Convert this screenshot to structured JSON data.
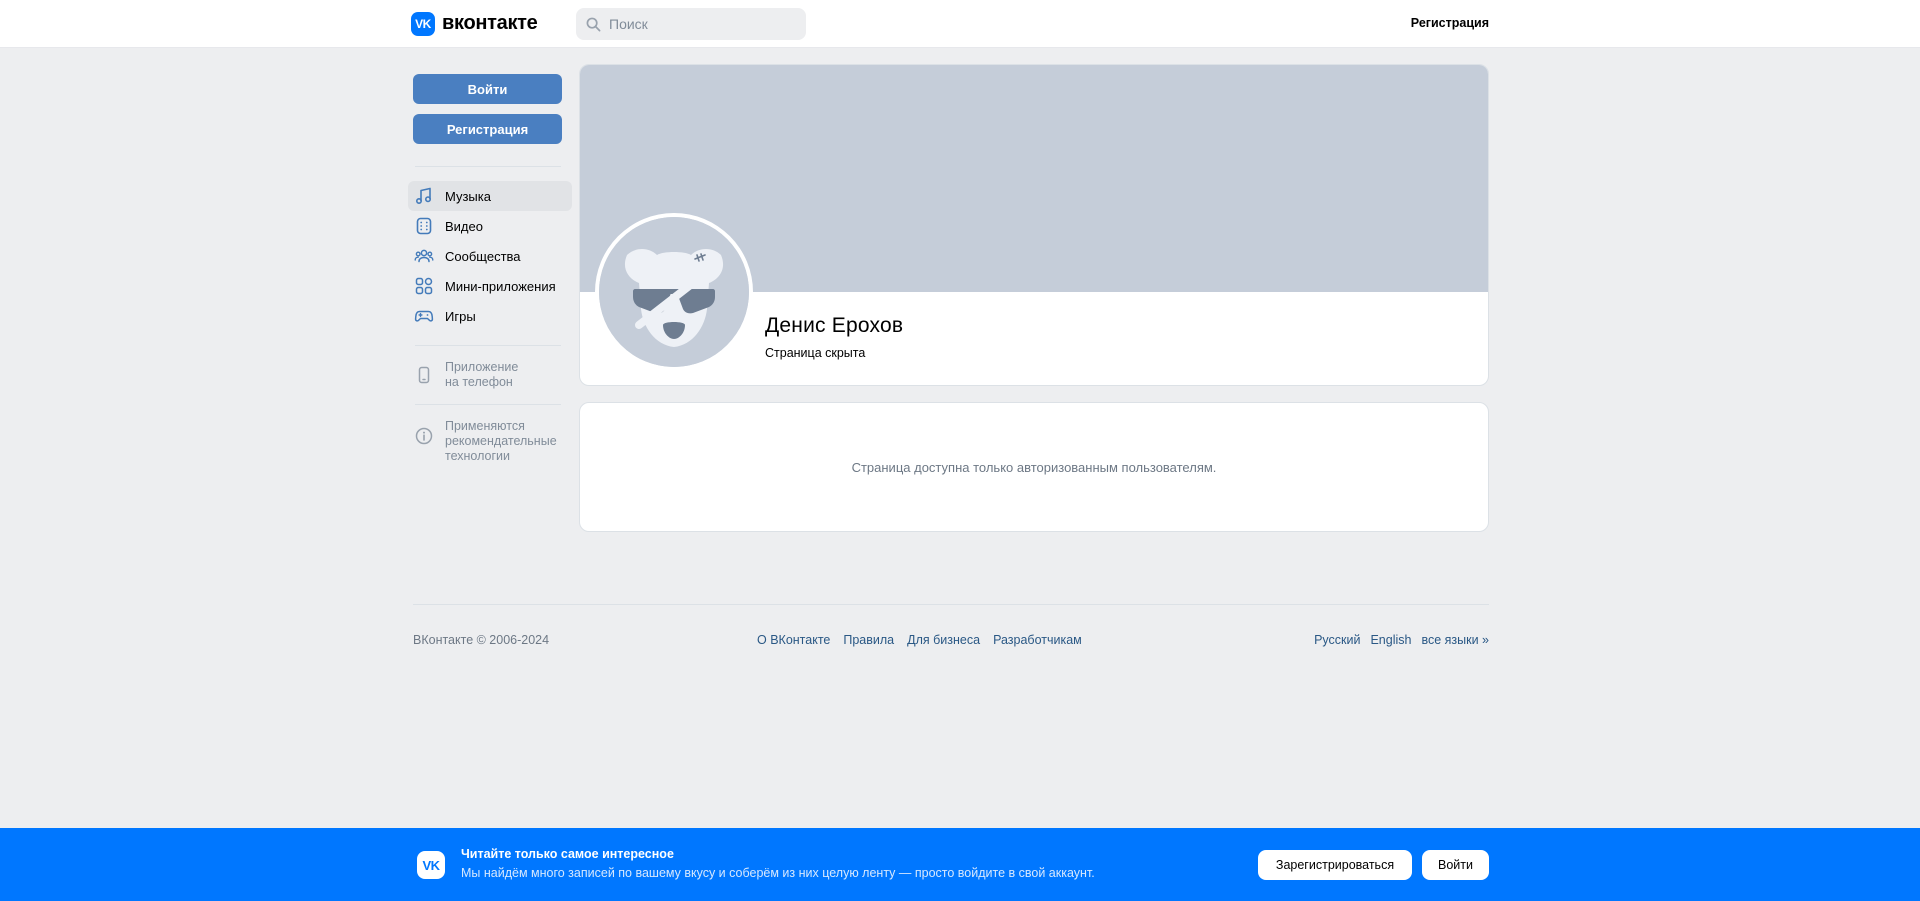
{
  "header": {
    "logo_badge": "VK",
    "logo_text": "вконтакте",
    "search_placeholder": "Поиск",
    "register_link": "Регистрация"
  },
  "sidebar": {
    "login_button": "Войти",
    "register_button": "Регистрация",
    "nav": [
      {
        "label": "Музыка",
        "icon": "music-icon"
      },
      {
        "label": "Видео",
        "icon": "video-icon"
      },
      {
        "label": "Сообщества",
        "icon": "communities-icon"
      },
      {
        "label": "Мини-приложения",
        "icon": "mini-apps-icon"
      },
      {
        "label": "Игры",
        "icon": "gamepad-icon"
      }
    ],
    "phone_app": {
      "line1": "Приложение",
      "line2": "на телефон"
    },
    "recommend": {
      "line1": "Применяются",
      "line2": "рекомендательные",
      "line3": "технологии"
    }
  },
  "profile": {
    "name": "Денис Ерохов",
    "status": "Страница скрыта"
  },
  "notice": {
    "text": "Страница доступна только авторизованным пользователям."
  },
  "footer": {
    "copyright": "ВКонтакте © 2006-2024",
    "links": [
      "О ВКонтакте",
      "Правила",
      "Для бизнеса",
      "Разработчикам"
    ],
    "languages": [
      "Русский",
      "English",
      "все языки »"
    ]
  },
  "banner": {
    "logo_badge": "VK",
    "title": "Читайте только самое интересное",
    "text": "Мы найдём много записей по вашему вкусу и соберём из них целую ленту — просто войдите в свой аккаунт.",
    "register_button": "Зарегистрироваться",
    "login_button": "Войти"
  },
  "colors": {
    "accent": "#0077ff",
    "button_blue": "#4a7fc1",
    "background": "#edeef0",
    "cover": "#c5cdd9"
  }
}
